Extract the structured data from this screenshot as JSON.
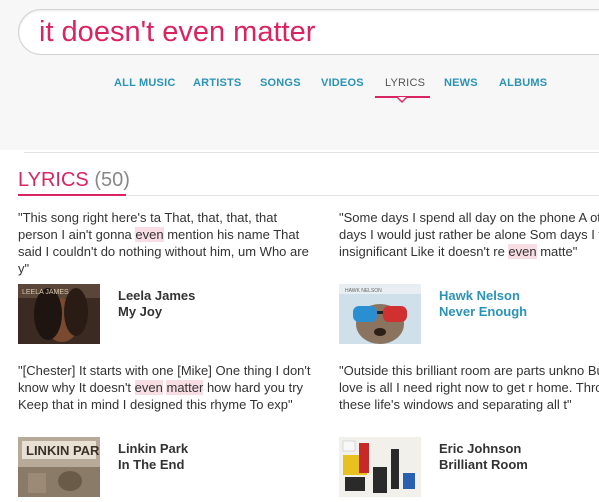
{
  "search": {
    "query": "it doesn't even matter"
  },
  "tabs": [
    {
      "label": "ALL MUSIC",
      "active": false
    },
    {
      "label": "ARTISTS",
      "active": false
    },
    {
      "label": "SONGS",
      "active": false
    },
    {
      "label": "VIDEOS",
      "active": false
    },
    {
      "label": "LYRICS",
      "active": true
    },
    {
      "label": "NEWS",
      "active": false
    },
    {
      "label": "ALBUMS",
      "active": false
    }
  ],
  "section": {
    "title": "LYRICS",
    "count": "(50)"
  },
  "colors": {
    "accent": "#d9245f",
    "link": "#2a93b8",
    "highlight": "#f8dde5"
  },
  "results": [
    {
      "snippet_parts": [
        "\"This song right here's ta That, that, that, that person I ain't gonna ",
        "even",
        " mention his name That said I couldn't do nothing without him, um Who are y\""
      ],
      "artist": "Leela James",
      "song": "My Joy",
      "artwork": "album-cover-leela-james"
    },
    {
      "snippet_parts": [
        "\"Some days I spend all day on the phone A other days I would just rather be alone Som days I feel so insignificant Like it doesn't re ",
        "even",
        " matte\""
      ],
      "artist": "Hawk Nelson",
      "song": "Never Enough",
      "artwork": "album-cover-hawk-nelson"
    },
    {
      "snippet_parts": [
        "\"[Chester] It starts with one [Mike] One thing I don't know why It doesn't ",
        "even",
        " ",
        "matter",
        " how hard you try Keep that in mind I designed this rhyme To exp\""
      ],
      "artist": "Linkin Park",
      "song": "In The End",
      "artwork": "album-cover-linkin-park"
    },
    {
      "snippet_parts": [
        "\"Outside this brilliant room are parts unkno But your love is all I need right now to get r home. Through these life's windows and separating all t\""
      ],
      "artist": "Eric Johnson",
      "song": "Brilliant Room",
      "artwork": "album-cover-eric-johnson"
    }
  ]
}
